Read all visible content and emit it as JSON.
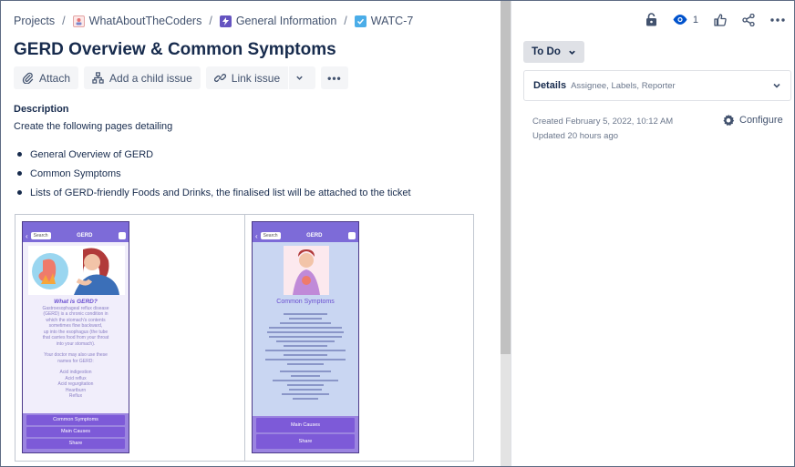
{
  "breadcrumb": {
    "items": [
      {
        "label": "Projects"
      },
      {
        "label": "WhatAboutTheCoders",
        "icon": "project-avatar-icon"
      },
      {
        "label": "General Information",
        "icon": "epic-lightning-icon"
      },
      {
        "label": "WATC-7",
        "icon": "task-checkbox-icon"
      }
    ],
    "separator": "/"
  },
  "issue": {
    "title": "GERD Overview & Common Symptoms"
  },
  "toolbar": {
    "attach": "Attach",
    "add_child": "Add a child issue",
    "link_issue": "Link issue",
    "more": "•••"
  },
  "description": {
    "label": "Description",
    "intro": "Create the following pages detailing",
    "bullets": [
      "General Overview of GERD",
      "Common Symptoms",
      "Lists of GERD-friendly Foods and Drinks, the finalised list will be attached to the ticket"
    ]
  },
  "mockups": {
    "phone1": {
      "search": "Search",
      "title": "GERD",
      "heading": "What is GERD?",
      "body": [
        "Gastroesophageal reflux disease",
        "(GERD) is a chronic condition in",
        "which the stomach's contents",
        "sometimes flow backward,",
        "up into the esophagus (the tube",
        "that carries food from your throat",
        "into your stomach).",
        "",
        "Your doctor may also use these",
        "names for GERD:",
        "",
        "Acid indigestion",
        "Acid reflux",
        "Acid regurgitation",
        "Heartburn",
        "Reflux"
      ],
      "buttons": [
        "Common Symptoms",
        "Main Causes",
        "Share"
      ]
    },
    "phone2": {
      "search": "Search",
      "title": "GERD",
      "heading": "Common Symptoms",
      "buttons": [
        "Main Causes",
        "Share"
      ]
    }
  },
  "sidebar": {
    "watchers_count": "1",
    "status": "To Do",
    "details_label": "Details",
    "details_sub": "Assignee, Labels, Reporter",
    "created": "Created February 5, 2022, 10:12 AM",
    "updated": "Updated 20 hours ago",
    "configure": "Configure"
  },
  "colors": {
    "accent": "#0052cc",
    "text": "#172b4d",
    "subtle": "#42526e",
    "phone_purple": "#7d5ad8"
  }
}
